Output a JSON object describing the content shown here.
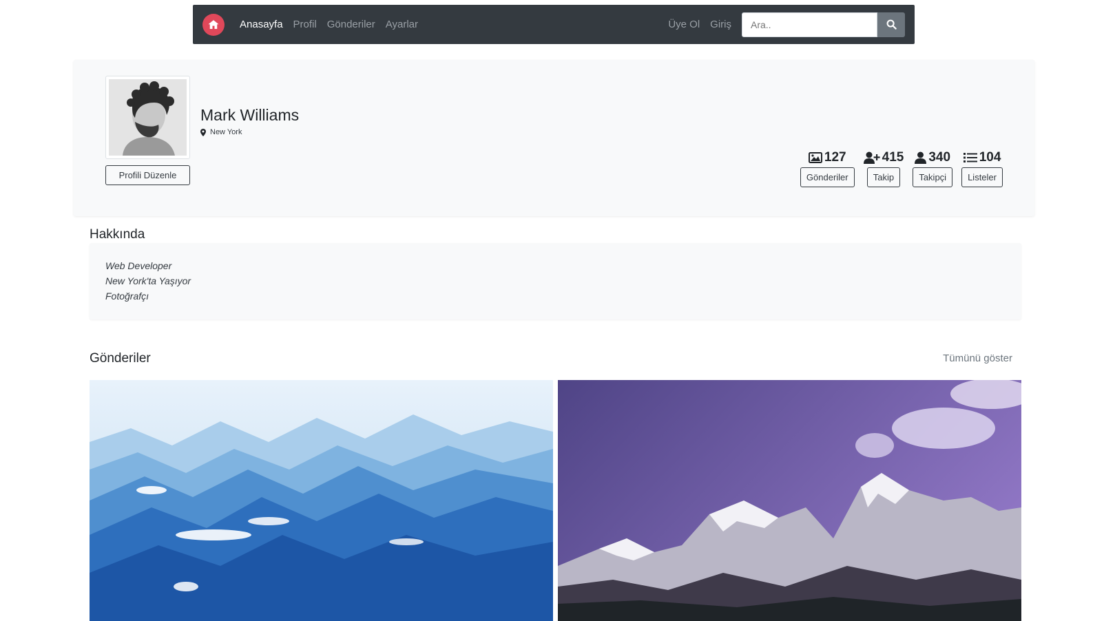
{
  "navbar": {
    "links": [
      {
        "label": "Anasayfa",
        "active": true
      },
      {
        "label": "Profil",
        "active": false
      },
      {
        "label": "Gönderiler",
        "active": false
      },
      {
        "label": "Ayarlar",
        "active": false
      }
    ],
    "right_links": [
      "Üye Ol",
      "Giriş"
    ],
    "search_placeholder": "Ara..",
    "logo_icon": "home-icon",
    "logo_color": "#e0485a"
  },
  "profile": {
    "name": "Mark Williams",
    "location": "New York",
    "edit_label": "Profili Düzenle",
    "stats": [
      {
        "icon": "image-icon",
        "count": "127",
        "label": "Gönderiler"
      },
      {
        "icon": "user-plus-icon",
        "count": "415",
        "label": "Takip"
      },
      {
        "icon": "user-icon",
        "count": "340",
        "label": "Takipçi"
      },
      {
        "icon": "list-icon",
        "count": "104",
        "label": "Listeler"
      }
    ]
  },
  "about": {
    "title": "Hakkında",
    "lines": [
      "Web Developer",
      "New York'ta Yaşıyor",
      "Fotoğrafçı"
    ]
  },
  "posts": {
    "title": "Gönderiler",
    "show_all": "Tümünü göster"
  }
}
